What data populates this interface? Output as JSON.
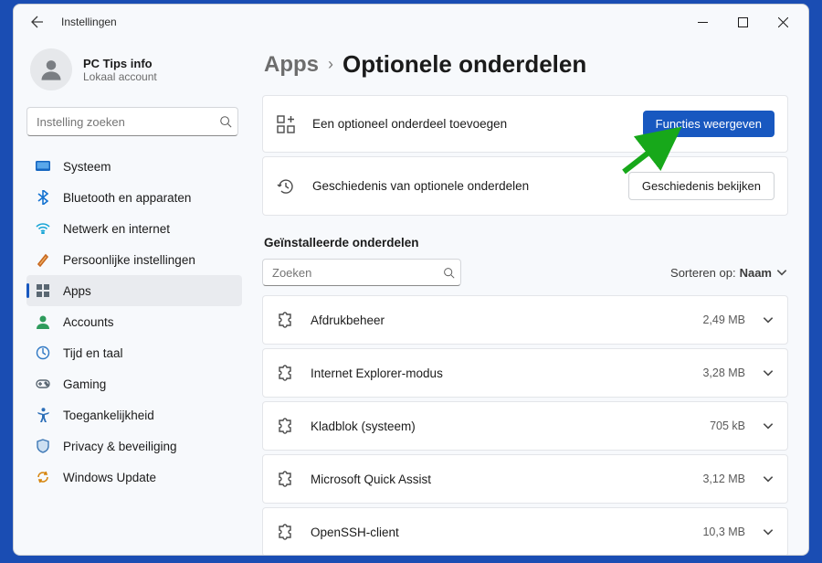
{
  "window": {
    "title": "Instellingen"
  },
  "profile": {
    "name": "PC Tips info",
    "subtitle": "Lokaal account"
  },
  "search": {
    "placeholder": "Instelling zoeken"
  },
  "sidebar": {
    "items": [
      {
        "label": "Systeem"
      },
      {
        "label": "Bluetooth en apparaten"
      },
      {
        "label": "Netwerk en internet"
      },
      {
        "label": "Persoonlijke instellingen"
      },
      {
        "label": "Apps"
      },
      {
        "label": "Accounts"
      },
      {
        "label": "Tijd en taal"
      },
      {
        "label": "Gaming"
      },
      {
        "label": "Toegankelijkheid"
      },
      {
        "label": "Privacy & beveiliging"
      },
      {
        "label": "Windows Update"
      }
    ]
  },
  "breadcrumb": {
    "parent": "Apps",
    "title": "Optionele onderdelen"
  },
  "actions": {
    "add_label": "Een optioneel onderdeel toevoegen",
    "add_button": "Functies weergeven",
    "history_label": "Geschiedenis van optionele onderdelen",
    "history_button": "Geschiedenis bekijken"
  },
  "installed": {
    "header": "Geïnstalleerde onderdelen",
    "search_placeholder": "Zoeken",
    "sort_label": "Sorteren op:",
    "sort_value": "Naam"
  },
  "items": [
    {
      "name": "Afdrukbeheer",
      "size": "2,49 MB"
    },
    {
      "name": "Internet Explorer-modus",
      "size": "3,28 MB"
    },
    {
      "name": "Kladblok (systeem)",
      "size": "705 kB"
    },
    {
      "name": "Microsoft Quick Assist",
      "size": "3,12 MB"
    },
    {
      "name": "OpenSSH-client",
      "size": "10,3 MB"
    }
  ]
}
